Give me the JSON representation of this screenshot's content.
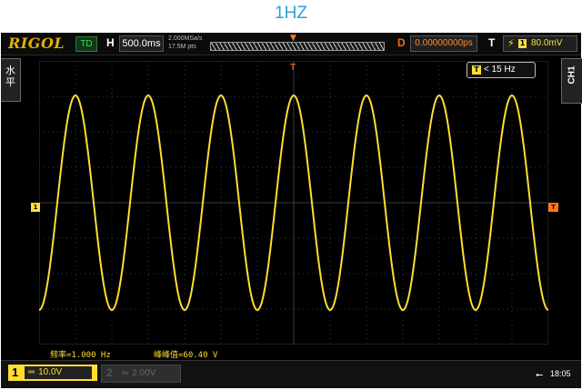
{
  "caption": "1HZ",
  "header": {
    "brand": "RIGOL",
    "run_state": "TD",
    "h_label": "H",
    "timebase": "500.0ms",
    "sample_rate": "2.000MSa/s",
    "memory_depth": "17.5M pts",
    "delay_label": "D",
    "delay_value": "0.00000000ps",
    "trigger_label": "T",
    "trigger_channel": "1",
    "trigger_level": "80.0mV"
  },
  "side_tabs": {
    "left": "水\n平",
    "right": "CH1"
  },
  "display": {
    "freq_counter_icon": "T",
    "freq_counter": "< 15 Hz",
    "trigger_position_marker": "T",
    "channel_marker": "1",
    "trigger_level_marker": "T",
    "measurements": {
      "frequency": "频率=1.000 Hz",
      "peak_to_peak": "峰峰值=60.40 V"
    },
    "waveform_color": "#ffdd33",
    "grid_color": "#3a3a3a"
  },
  "bottom": {
    "ch1": {
      "number": "1",
      "scale": "10.0V",
      "coupling_icon": "dc-coupling-icon"
    },
    "ch2": {
      "number": "2",
      "scale": "2.00V",
      "coupling_icon": "dc-coupling-icon"
    },
    "usb_icon": "usb-icon",
    "time": "18:05"
  }
}
